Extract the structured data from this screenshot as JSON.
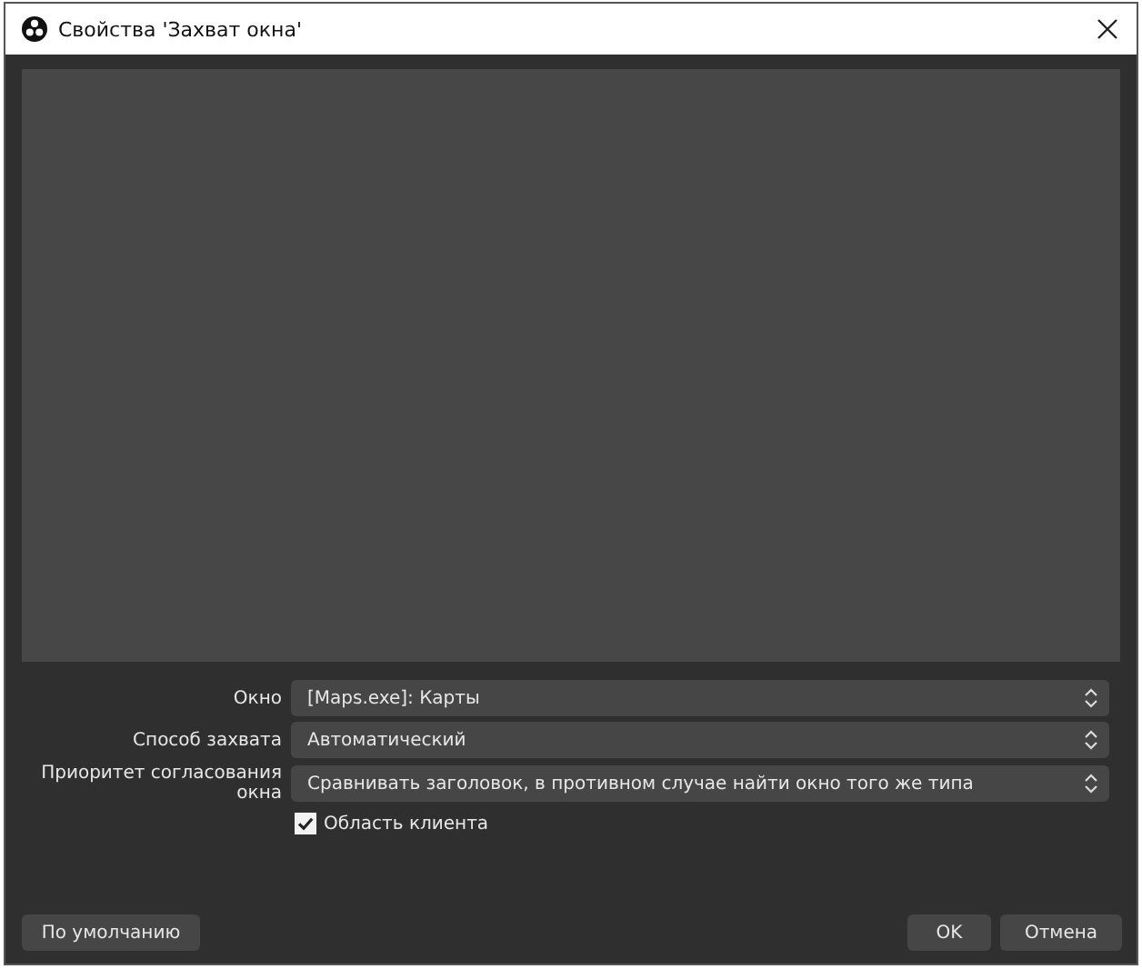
{
  "window": {
    "title": "Свойства 'Захват окна'"
  },
  "properties": [
    {
      "label": "Окно",
      "value": "[Maps.exe]: Карты"
    },
    {
      "label": "Способ захвата",
      "value": "Автоматический"
    },
    {
      "label": "Приоритет согласования окна",
      "value": "Сравнивать заголовок, в противном случае найти окно того же типа"
    }
  ],
  "checkbox": {
    "label": "Область клиента",
    "checked": true
  },
  "buttons": {
    "defaults": "По умолчанию",
    "ok": "OK",
    "cancel": "Отмена"
  }
}
